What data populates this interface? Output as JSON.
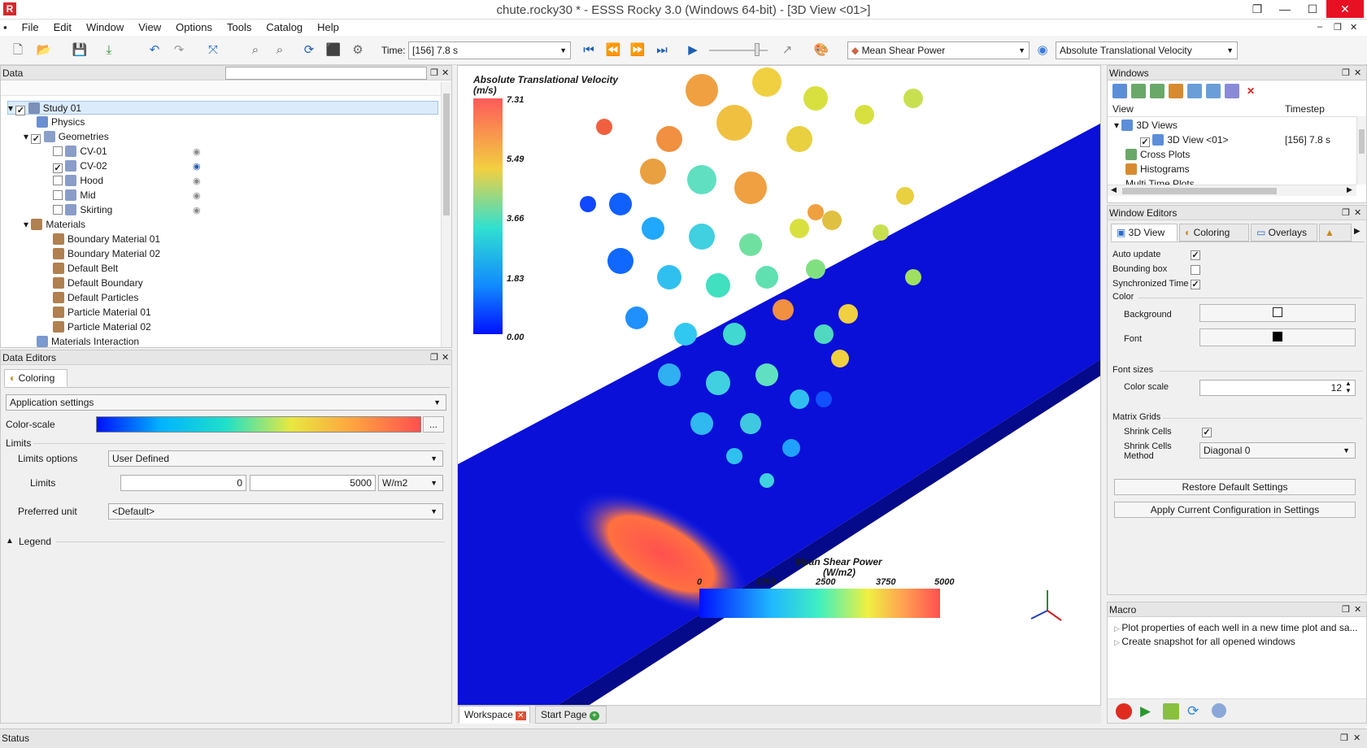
{
  "window": {
    "title": "chute.rocky30 * - ESSS Rocky 3.0 (Windows 64-bit) - [3D View <01>]",
    "app_icon": "R"
  },
  "menu": [
    "File",
    "Edit",
    "Window",
    "View",
    "Options",
    "Tools",
    "Catalog",
    "Help"
  ],
  "toolbar": {
    "time_label": "Time:",
    "time_value": "[156] 7.8 s",
    "color_property": "Mean Shear Power",
    "particle_property": "Absolute Translational Velocity"
  },
  "data_panel": {
    "title": "Data",
    "search_placeholder": "",
    "tree": [
      {
        "label": "Study 01",
        "checked": true,
        "selected": true
      },
      {
        "label": "Physics"
      },
      {
        "label": "Geometries",
        "checked": true
      },
      {
        "label": "CV-01",
        "checked": false
      },
      {
        "label": "CV-02",
        "checked": true
      },
      {
        "label": "Hood",
        "checked": false
      },
      {
        "label": "Mid",
        "checked": false
      },
      {
        "label": "Skirting",
        "checked": false
      },
      {
        "label": "Materials"
      },
      {
        "label": "Boundary Material 01"
      },
      {
        "label": "Boundary Material 02"
      },
      {
        "label": "Default Belt"
      },
      {
        "label": "Default Boundary"
      },
      {
        "label": "Default Particles"
      },
      {
        "label": "Particle Material 01"
      },
      {
        "label": "Particle Material 02"
      },
      {
        "label": "Materials Interaction"
      }
    ]
  },
  "data_editors": {
    "title": "Data Editors",
    "tab": "Coloring",
    "settings_scope": "Application settings",
    "colorscale_label": "Color-scale",
    "colorscale_btn": "...",
    "limits_section": "Limits",
    "limits_options_label": "Limits options",
    "limits_options_value": "User Defined",
    "limits_label": "Limits",
    "limit_min": "0",
    "limit_max": "5000",
    "limit_unit": "W/m2",
    "preferred_unit_label": "Preferred unit",
    "preferred_unit_value": "<Default>",
    "legend_label": "Legend"
  },
  "viewport": {
    "velocity_legend": {
      "title": "Absolute Translational Velocity",
      "unit": "(m/s)",
      "ticks": [
        "7.31",
        "5.49",
        "3.66",
        "1.83",
        "0.00"
      ]
    },
    "shear_legend": {
      "title": "Mean Shear Power",
      "unit": "(W/m2)",
      "ticks": [
        "0",
        "1250",
        "2500",
        "3750",
        "5000"
      ]
    },
    "tabs": [
      "Workspace",
      "Start Page"
    ]
  },
  "windows_panel": {
    "title": "Windows",
    "col_view": "View",
    "col_timestep": "Timestep",
    "items": [
      {
        "label": "3D Views"
      },
      {
        "label": "3D View <01>",
        "timestep": "[156] 7.8 s",
        "checked": true
      },
      {
        "label": "Cross Plots"
      },
      {
        "label": "Histograms"
      },
      {
        "label": "Multi Time Plots"
      }
    ]
  },
  "window_editors": {
    "title": "Window Editors",
    "tabs": [
      "3D View",
      "Coloring",
      "Overlays"
    ],
    "auto_update": "Auto update",
    "bounding_box": "Bounding box",
    "synchronized_time": "Synchronized Time",
    "color_section": "Color",
    "background_label": "Background",
    "font_label": "Font",
    "font_sizes_section": "Font sizes",
    "color_scale_label": "Color scale",
    "color_scale_value": "12",
    "matrix_grids_section": "Matrix Grids",
    "shrink_cells_label": "Shrink Cells",
    "shrink_method_label1": "Shrink Cells",
    "shrink_method_label2": "Method",
    "shrink_method_value": "Diagonal 0",
    "restore_btn": "Restore Default Settings",
    "apply_btn": "Apply Current Configuration in Settings"
  },
  "macro": {
    "title": "Macro",
    "items": [
      "Plot properties of each well in a new time plot and sa...",
      "Create snapshot for all opened windows"
    ]
  },
  "status": {
    "label": "Status"
  }
}
